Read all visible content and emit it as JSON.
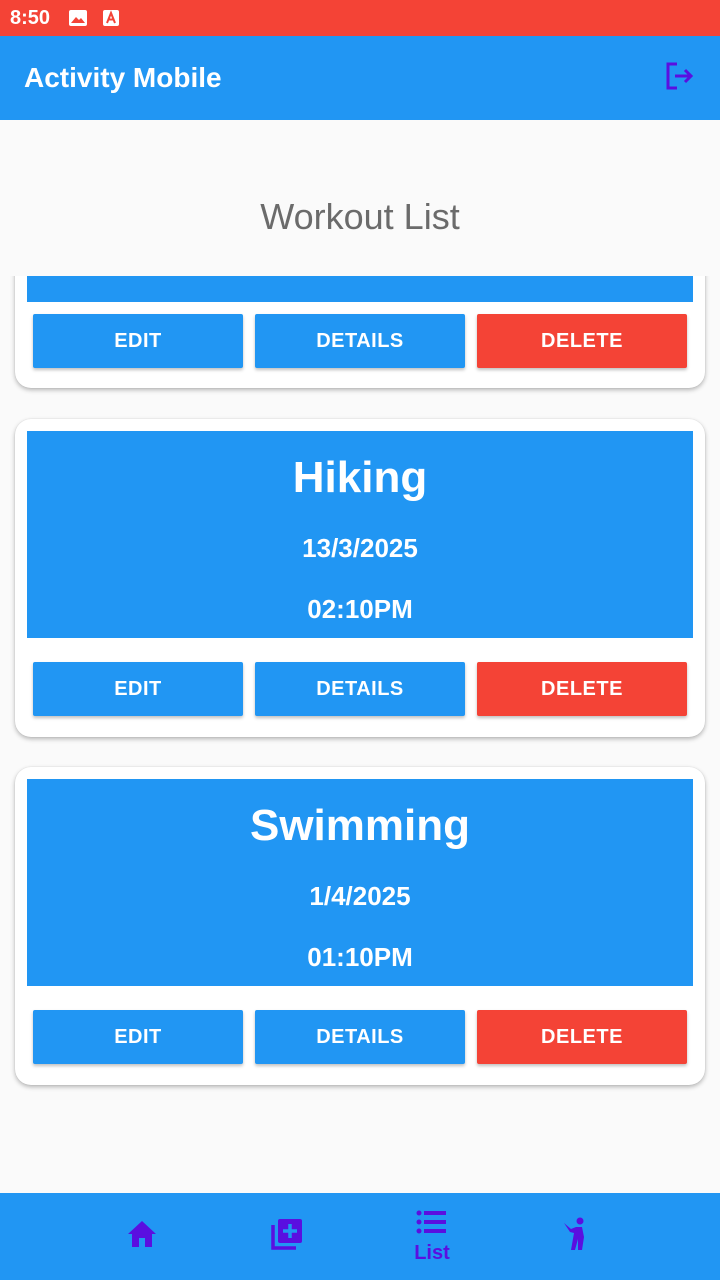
{
  "status_bar": {
    "time": "8:50",
    "icons": [
      "image-icon",
      "text-a-icon"
    ],
    "color": "#F44336"
  },
  "app_bar": {
    "title": "Activity Mobile",
    "action_icon": "logout-icon",
    "color": "#2196F3"
  },
  "page": {
    "heading": "Workout List"
  },
  "workouts": [
    {
      "title": "",
      "date": "",
      "time": "",
      "partially_visible": true
    },
    {
      "title": "Hiking",
      "date": "13/3/2025",
      "time": "02:10PM"
    },
    {
      "title": "Swimming",
      "date": "1/4/2025",
      "time": "01:10PM"
    }
  ],
  "buttons": {
    "edit": "EDIT",
    "details": "DETAILS",
    "delete": "DELETE"
  },
  "bottom_nav": {
    "items": [
      {
        "icon": "home-icon",
        "label": ""
      },
      {
        "icon": "add-library-icon",
        "label": ""
      },
      {
        "icon": "list-icon",
        "label": "List",
        "active": true
      },
      {
        "icon": "person-activity-icon",
        "label": ""
      }
    ],
    "icon_color": "#5A0FE0"
  },
  "colors": {
    "primary": "#2196F3",
    "danger": "#F44336",
    "accent": "#5A0FE0"
  }
}
